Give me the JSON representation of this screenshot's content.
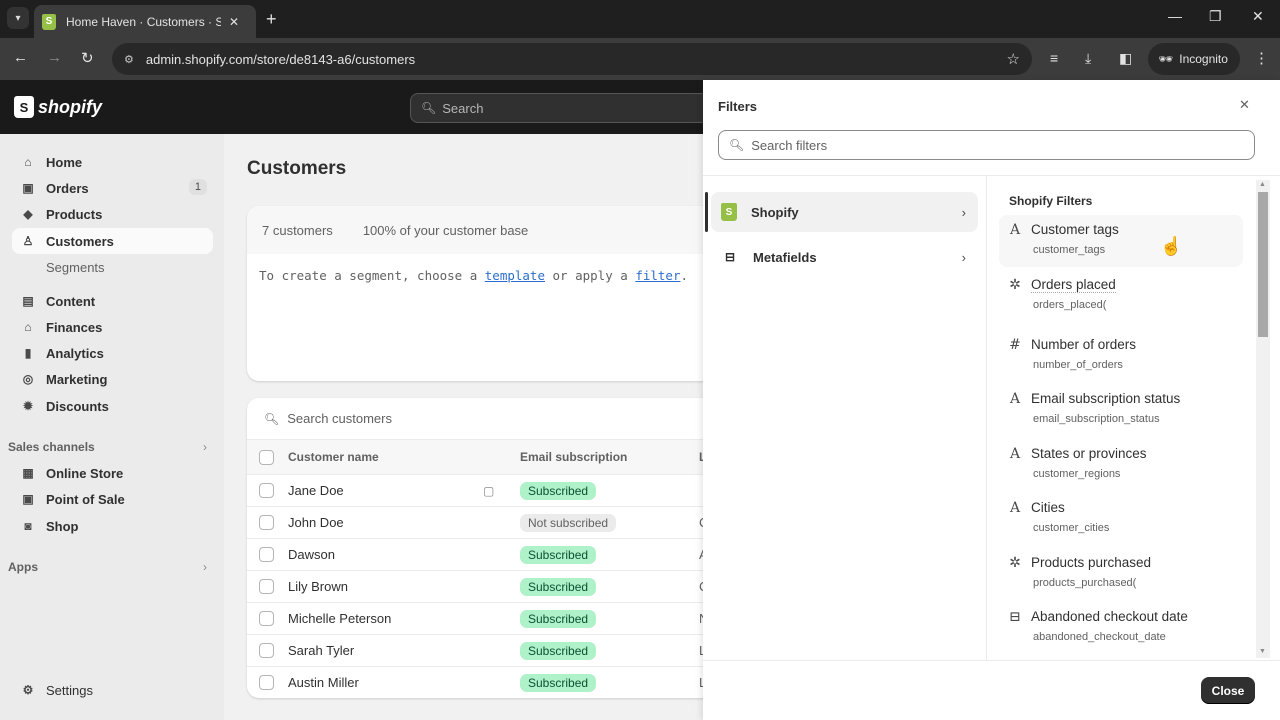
{
  "browser": {
    "tab_title": "Home Haven · Customers · Shopify",
    "url": "admin.shopify.com/store/de8143-a6/customers",
    "incognito_label": "Incognito"
  },
  "shopify": {
    "logo_text": "shopify",
    "search_placeholder": "Search"
  },
  "sidebar": {
    "items": [
      {
        "label": "Home",
        "icon": "home-icon"
      },
      {
        "label": "Orders",
        "icon": "inbox-icon",
        "badge": "1"
      },
      {
        "label": "Products",
        "icon": "tag-icon"
      },
      {
        "label": "Customers",
        "icon": "person-icon",
        "active": true
      },
      {
        "label": "Segments",
        "sub": true
      },
      {
        "label": "Content",
        "icon": "content-icon"
      },
      {
        "label": "Finances",
        "icon": "bank-icon"
      },
      {
        "label": "Analytics",
        "icon": "bar-chart-icon"
      },
      {
        "label": "Marketing",
        "icon": "target-icon"
      },
      {
        "label": "Discounts",
        "icon": "discount-icon"
      }
    ],
    "sales_channels_label": "Sales channels",
    "channels": [
      {
        "label": "Online Store",
        "icon": "store-icon"
      },
      {
        "label": "Point of Sale",
        "icon": "pos-icon"
      },
      {
        "label": "Shop",
        "icon": "shop-icon"
      }
    ],
    "apps_label": "Apps",
    "settings_label": "Settings"
  },
  "main": {
    "title": "Customers",
    "segment": {
      "count": "7 customers",
      "percent": "100% of your customer base",
      "hint_pre": "To create a segment, choose a ",
      "hint_link1": "template",
      "hint_mid": " or apply a ",
      "hint_link2": "filter",
      "hint_post": "."
    },
    "table": {
      "search_placeholder": "Search customers",
      "headers": [
        "Customer name",
        "Email subscription",
        "L"
      ],
      "rows": [
        {
          "name": "Jane Doe",
          "email": "Subscribed",
          "status": "sub",
          "note": true,
          "cut": ""
        },
        {
          "name": "John Doe",
          "email": "Not subscribed",
          "status": "not",
          "cut": "C"
        },
        {
          "name": "Dawson",
          "email": "Subscribed",
          "status": "sub",
          "cut": "A"
        },
        {
          "name": "Lily Brown",
          "email": "Subscribed",
          "status": "sub",
          "cut": "C"
        },
        {
          "name": "Michelle Peterson",
          "email": "Subscribed",
          "status": "sub",
          "cut": "N"
        },
        {
          "name": "Sarah Tyler",
          "email": "Subscribed",
          "status": "sub",
          "cut": "L"
        },
        {
          "name": "Austin Miller",
          "email": "Subscribed",
          "status": "sub",
          "cut": "L"
        }
      ]
    }
  },
  "filters": {
    "title": "Filters",
    "search_placeholder": "Search filters",
    "categories": [
      {
        "label": "Shopify",
        "active": true
      },
      {
        "label": "Metafields"
      }
    ],
    "section_title": "Shopify Filters",
    "items": [
      {
        "label": "Customer tags",
        "key": "customer_tags",
        "icon": "A",
        "icon_name": "text-type-icon"
      },
      {
        "label": "Orders placed",
        "key": "orders_placed(",
        "icon": "✲",
        "icon_name": "function-icon",
        "dotted": true
      },
      {
        "label": "Number of orders",
        "key": "number_of_orders",
        "icon": "#",
        "icon_name": "hash-icon"
      },
      {
        "label": "Email subscription status",
        "key": "email_subscription_status",
        "icon": "A",
        "icon_name": "text-type-icon"
      },
      {
        "label": "States or provinces",
        "key": "customer_regions",
        "icon": "A",
        "icon_name": "text-type-icon"
      },
      {
        "label": "Cities",
        "key": "customer_cities",
        "icon": "A",
        "icon_name": "text-type-icon"
      },
      {
        "label": "Products purchased",
        "key": "products_purchased(",
        "icon": "✲",
        "icon_name": "function-icon"
      },
      {
        "label": "Abandoned checkout date",
        "key": "abandoned_checkout_date",
        "icon": "⊟",
        "icon_name": "calendar-icon"
      }
    ],
    "close_label": "Close"
  }
}
